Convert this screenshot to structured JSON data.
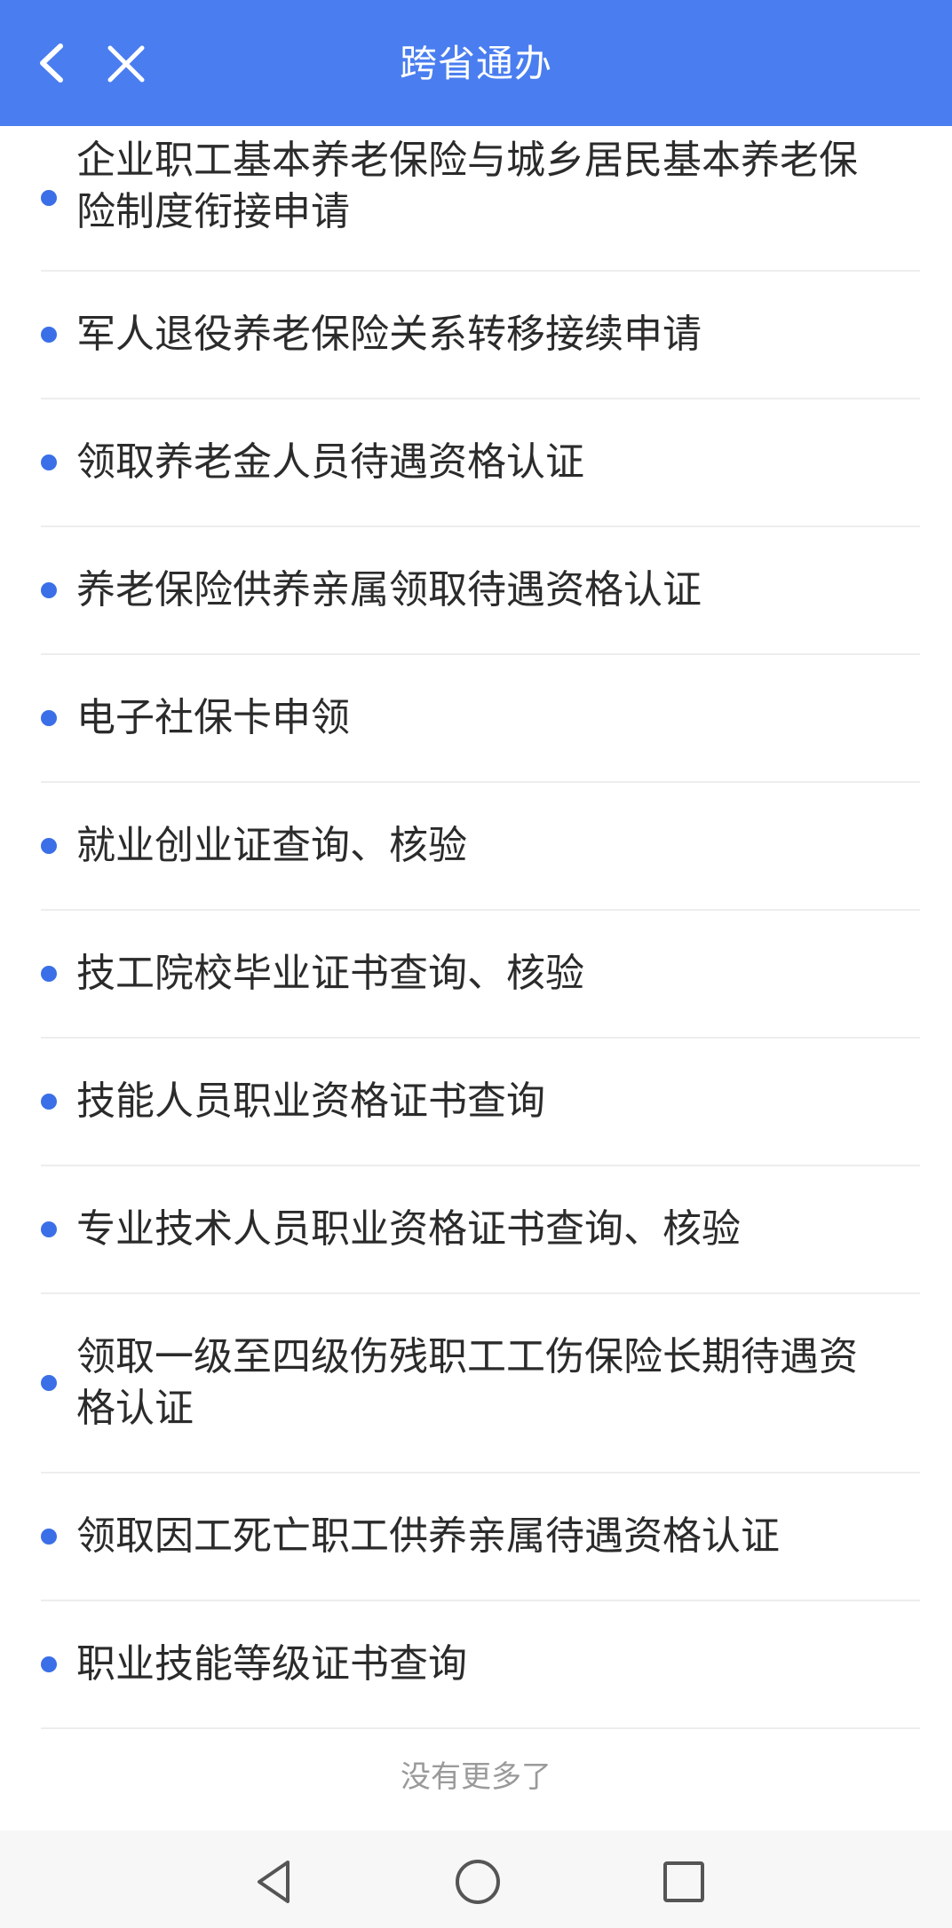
{
  "header": {
    "title": "跨省通办",
    "back_icon": "chevron-left-icon",
    "close_icon": "close-icon",
    "background": "#4a7ef0"
  },
  "services": [
    {
      "label": "企业职工基本养老保险与城乡居民基本养老保险制度衔接申请"
    },
    {
      "label": "军人退役养老保险关系转移接续申请"
    },
    {
      "label": "领取养老金人员待遇资格认证"
    },
    {
      "label": "养老保险供养亲属领取待遇资格认证"
    },
    {
      "label": "电子社保卡申领"
    },
    {
      "label": "就业创业证查询、核验"
    },
    {
      "label": "技工院校毕业证书查询、核验"
    },
    {
      "label": "技能人员职业资格证书查询"
    },
    {
      "label": "专业技术人员职业资格证书查询、核验"
    },
    {
      "label": "领取一级至四级伤残职工工伤保险长期待遇资格认证"
    },
    {
      "label": "领取因工死亡职工供养亲属待遇资格认证"
    },
    {
      "label": "职业技能等级证书查询"
    }
  ],
  "footer": {
    "end_text": "没有更多了"
  },
  "system_nav": {
    "back_icon": "triangle-back-icon",
    "home_icon": "circle-home-icon",
    "recent_icon": "square-recent-icon"
  }
}
